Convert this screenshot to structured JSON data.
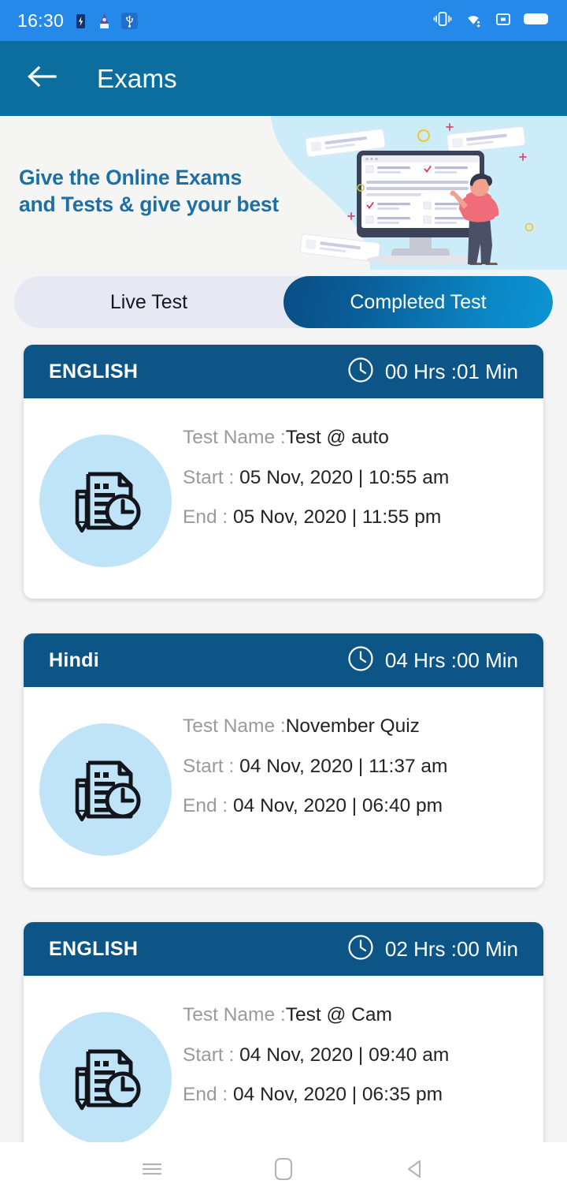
{
  "status_bar": {
    "time": "16:30",
    "left_icons": [
      "battery-saver-icon",
      "app-notification-icon",
      "usb-icon"
    ],
    "right_icons": [
      "vibrate-icon",
      "wifi-icon",
      "sd-card-icon",
      "battery-icon"
    ],
    "background_color": "#2489e8"
  },
  "app_bar": {
    "title": "Exams",
    "back_icon": "arrow-left-icon",
    "background_color": "#0b6e9e"
  },
  "banner": {
    "line1": "Give the Online Exams",
    "line2": "and Tests & give your best",
    "text_color": "#1d6fa5",
    "illustration": "online-exam-illustration"
  },
  "tabs": {
    "items": [
      {
        "label": "Live Test",
        "active": false
      },
      {
        "label": "Completed Test",
        "active": true
      }
    ],
    "inactive_background": "#e6e8f2",
    "active_gradient_start": "#0a4d86",
    "active_gradient_end": "#0c95d4"
  },
  "labels": {
    "test_name": "Test Name :",
    "start": "Start : ",
    "end": "End : ",
    "clock_icon": "clock-icon",
    "card_icon": "exam-document-clock-icon"
  },
  "cards": [
    {
      "subject": "ENGLISH",
      "duration": "00 Hrs :01 Min",
      "test_name": "Test @ auto",
      "start": "05 Nov, 2020 | 10:55 am",
      "end": "05 Nov, 2020 | 11:55 pm"
    },
    {
      "subject": "Hindi",
      "duration": "04 Hrs :00 Min",
      "test_name": "November Quiz",
      "start": "04 Nov, 2020 | 11:37 am",
      "end": "04 Nov, 2020 | 06:40 pm"
    },
    {
      "subject": "ENGLISH",
      "duration": "02 Hrs :00 Min",
      "test_name": "Test @ Cam",
      "start": "04 Nov, 2020 | 09:40 am",
      "end": "04 Nov, 2020 | 06:35 pm"
    }
  ],
  "nav_bar": {
    "items": [
      "recents-icon",
      "home-icon",
      "back-icon"
    ]
  },
  "colors": {
    "page_background": "#f4f4f4",
    "card_header": "#0d5587",
    "icon_circle": "#bfe4f8"
  }
}
